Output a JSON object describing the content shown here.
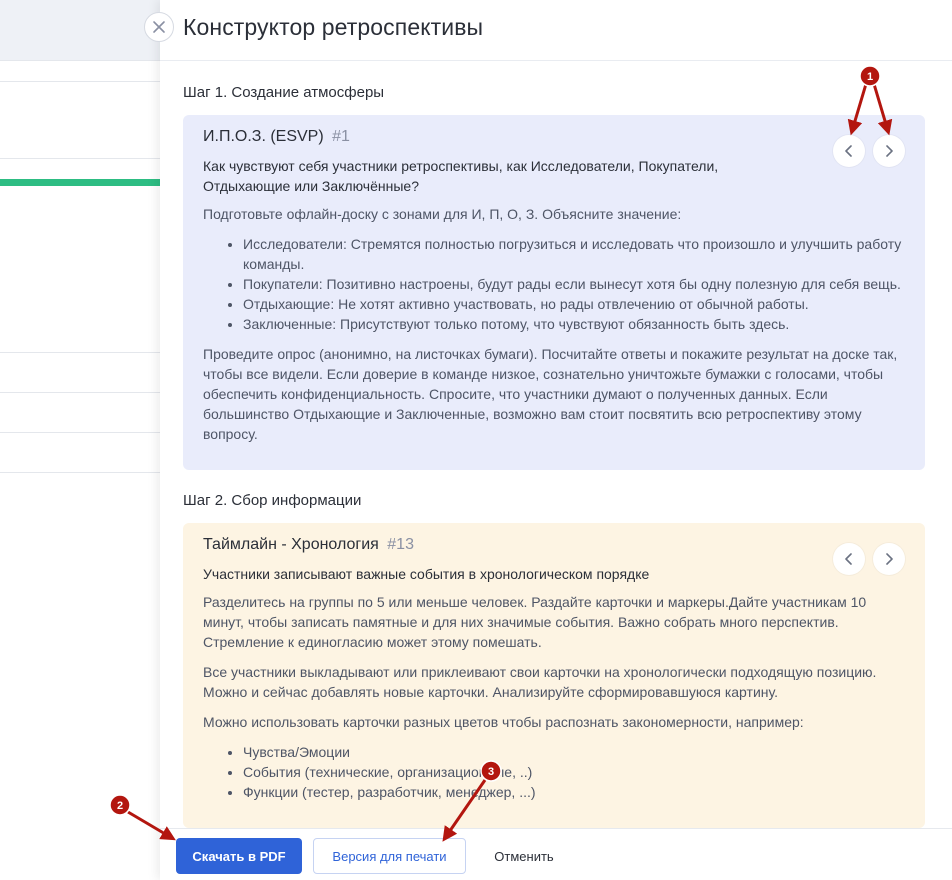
{
  "drawer": {
    "title": "Конструктор ретроспективы"
  },
  "steps": [
    {
      "heading": "Шаг 1. Создание атмосферы",
      "card": {
        "title": "И.П.О.З. (ESVP)",
        "number": "#1",
        "question": "Как чувствуют себя участники ретроспективы, как Исследователи, Покупатели, Отдыхающие или Заключённые?",
        "intro": "Подготовьте офлайн-доску с зонами для И, П, О, З. Объясните значение:",
        "bullets": [
          "Исследователи: Стремятся полностью погрузиться и исследовать что произошло и улучшить работу команды.",
          "Покупатели: Позитивно настроены, будут рады если вынесут хотя бы одну полезную для себя вещь.",
          "Отдыхающие: Не хотят активно участвовать, но рады отвлечению от обычной работы.",
          "Заключенные: Присутствуют только потому, что чувствуют обязанность быть здесь."
        ],
        "outro": "Проведите опрос (анонимно, на листочках бумаги). Посчитайте ответы и покажите результат на доске так, чтобы все видели. Если доверие в команде низкое, сознательно уничтожьте бумажки с голосами, чтобы обеспечить конфиденциальность. Спросите, что участники думают о полученных данных. Если большинство Отдыхающие и Заключенные, возможно вам стоит посвятить всю ретроспективу этому вопросу."
      }
    },
    {
      "heading": "Шаг 2. Сбор информации",
      "card": {
        "title": "Таймлайн - Хронология",
        "number": "#13",
        "question": "Участники записывают важные события в хронологическом порядке",
        "p1": "Разделитесь на группы по 5 или меньше человек. Раздайте карточки и маркеры.Дайте участникам 10 минут, чтобы записать памятные и для них значимые события. Важно собрать много перспектив. Стремление к единогласию может этому помешать.",
        "p2": "Все участники выкладывают или приклеивают свои карточки на хронологически подходящую позицию. Можно и сейчас добавлять новые карточки. Анализируйте сформировавшуюся картину.",
        "p3": "Можно использовать карточки разных цветов чтобы распознать закономерности, например:",
        "bullets": [
          "Чувства/Эмоции",
          "События (технические, организационные, ..)",
          "Функции (тестер, разработчик, менеджер, ...)"
        ]
      }
    }
  ],
  "footer": {
    "pdf_label": "Скачать в PDF",
    "print_label": "Версия для печати",
    "cancel_label": "Отменить"
  },
  "annotations": {
    "markers": [
      "1",
      "2",
      "3"
    ],
    "color": "#b3160f"
  },
  "colors": {
    "primary": "#2f63d8",
    "card_blue": "#e9ecfb",
    "card_yellow": "#fdf4e3",
    "progress": "#2dbd83"
  }
}
